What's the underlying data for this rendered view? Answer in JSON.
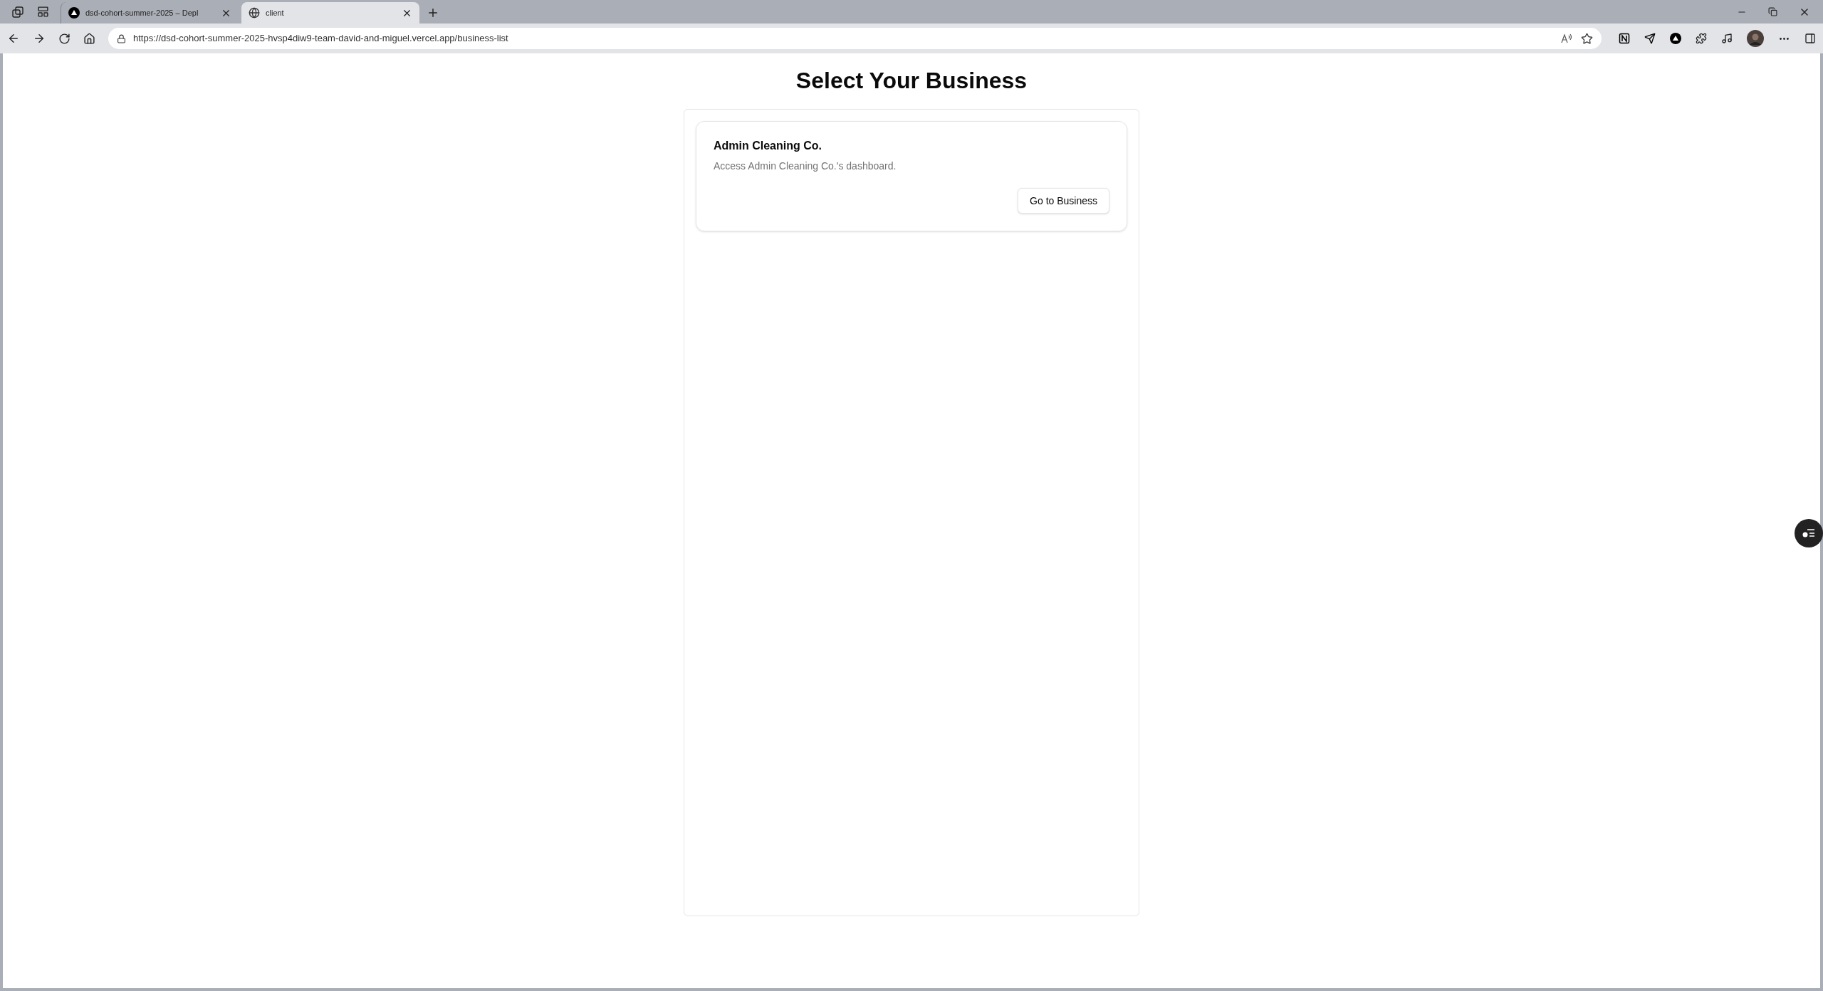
{
  "browser": {
    "tabs": [
      {
        "title": "dsd-cohort-summer-2025 – Depl",
        "kind": "triangle",
        "selected": false
      },
      {
        "title": "client",
        "kind": "globe",
        "selected": true
      }
    ],
    "url": "https://dsd-cohort-summer-2025-hvsp4diw9-team-david-and-miguel.vercel.app/business-list"
  },
  "page": {
    "title": "Select Your Business",
    "businesses": [
      {
        "name": "Admin Cleaning Co.",
        "description": "Access Admin Cleaning Co.'s dashboard.",
        "button": "Go to Business"
      }
    ]
  }
}
